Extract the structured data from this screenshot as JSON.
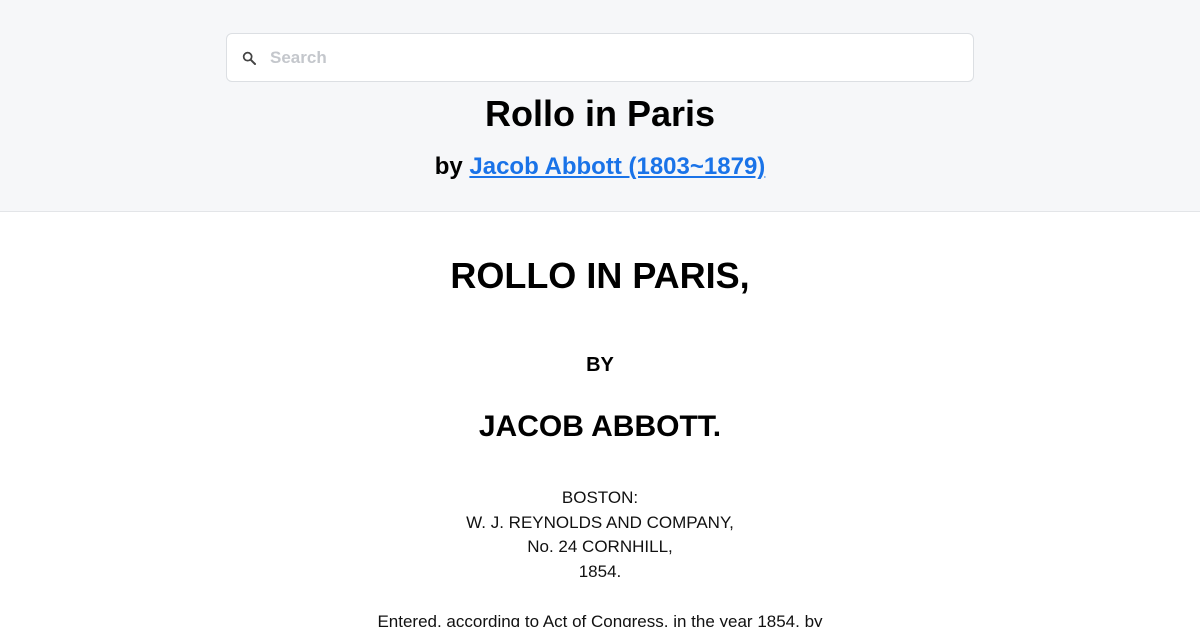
{
  "search": {
    "placeholder": "Search",
    "icon": "search-icon"
  },
  "header": {
    "title": "Rollo in Paris",
    "by_prefix": "by",
    "author_link": "Jacob Abbott (1803~1879)",
    "link_color": "#1a73e8"
  },
  "content": {
    "title": "ROLLO IN PARIS,",
    "by": "BY",
    "author": "JACOB ABBOTT.",
    "publisher_lines": [
      "BOSTON:",
      "W. J. REYNOLDS AND COMPANY,",
      "No. 24 CORNHILL,",
      "1854."
    ],
    "entered": "Entered, according to Act of Congress, in the year 1854, by"
  }
}
